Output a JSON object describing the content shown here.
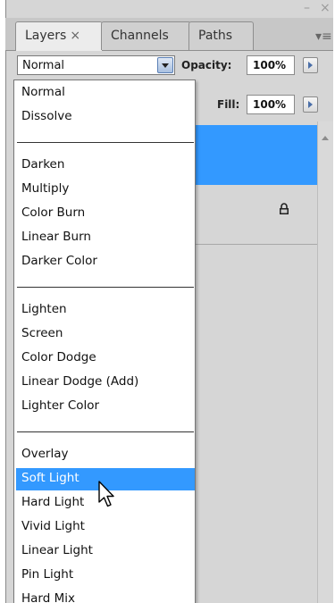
{
  "window": {
    "minimize_glyph": "–",
    "close_glyph": "×"
  },
  "tabs": [
    {
      "label": "Layers",
      "close": "×",
      "active": true
    },
    {
      "label": "Channels",
      "active": false
    },
    {
      "label": "Paths",
      "active": false
    }
  ],
  "panel_menu_glyph": "▾≡",
  "toolbar": {
    "blend_mode_value": "Normal",
    "opacity_label": "Opacity:",
    "opacity_value": "100%",
    "fill_label": "Fill:",
    "fill_value": "100%"
  },
  "dropdown": {
    "groups": [
      [
        "Normal",
        "Dissolve"
      ],
      [
        "Darken",
        "Multiply",
        "Color Burn",
        "Linear Burn",
        "Darker Color"
      ],
      [
        "Lighten",
        "Screen",
        "Color Dodge",
        "Linear Dodge (Add)",
        "Lighter Color"
      ],
      [
        "Overlay",
        "Soft Light",
        "Hard Light",
        "Vivid Light",
        "Linear Light",
        "Pin Light",
        "Hard Mix"
      ]
    ],
    "highlighted": "Soft Light"
  },
  "icons": {
    "lock": "lock-icon",
    "cursor": "arrow-cursor-icon",
    "dropdown_arrow": "chevron-down-icon"
  },
  "colors": {
    "highlight": "#3399ff",
    "panel_bg": "#d6d6d6",
    "menu_bg": "#ffffff"
  }
}
